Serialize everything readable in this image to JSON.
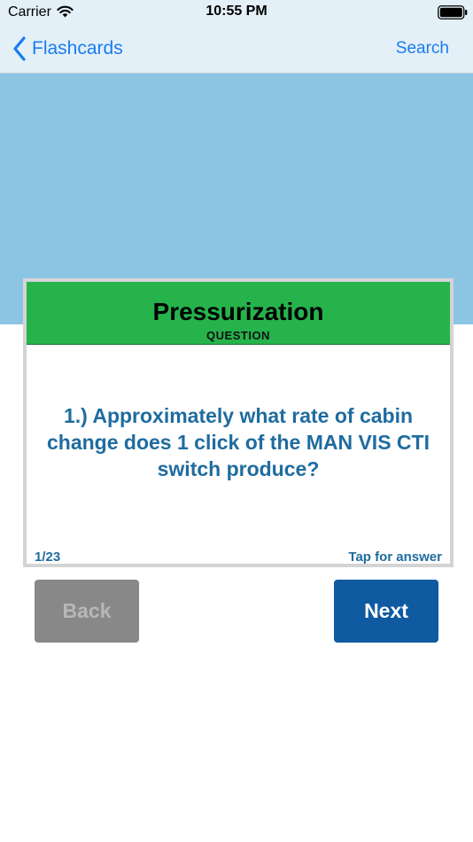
{
  "status_bar": {
    "carrier": "Carrier",
    "time": "10:55 PM",
    "icons": [
      "wifi-icon",
      "battery-icon"
    ]
  },
  "nav": {
    "back_label": "Flashcards",
    "search_label": "Search",
    "accent_color": "#1b7bf0"
  },
  "card": {
    "title": "Pressurization",
    "kind": "QUESTION",
    "question": "1.)  Approximately what rate of cabin change does 1 click of the MAN VIS CTI switch produce?",
    "counter": "1/23",
    "hint": "Tap for answer",
    "header_color": "#26b34b",
    "text_color": "#1f6c9f"
  },
  "buttons": {
    "back_label": "Back",
    "back_enabled": false,
    "next_label": "Next",
    "next_color": "#0f5aa1"
  }
}
